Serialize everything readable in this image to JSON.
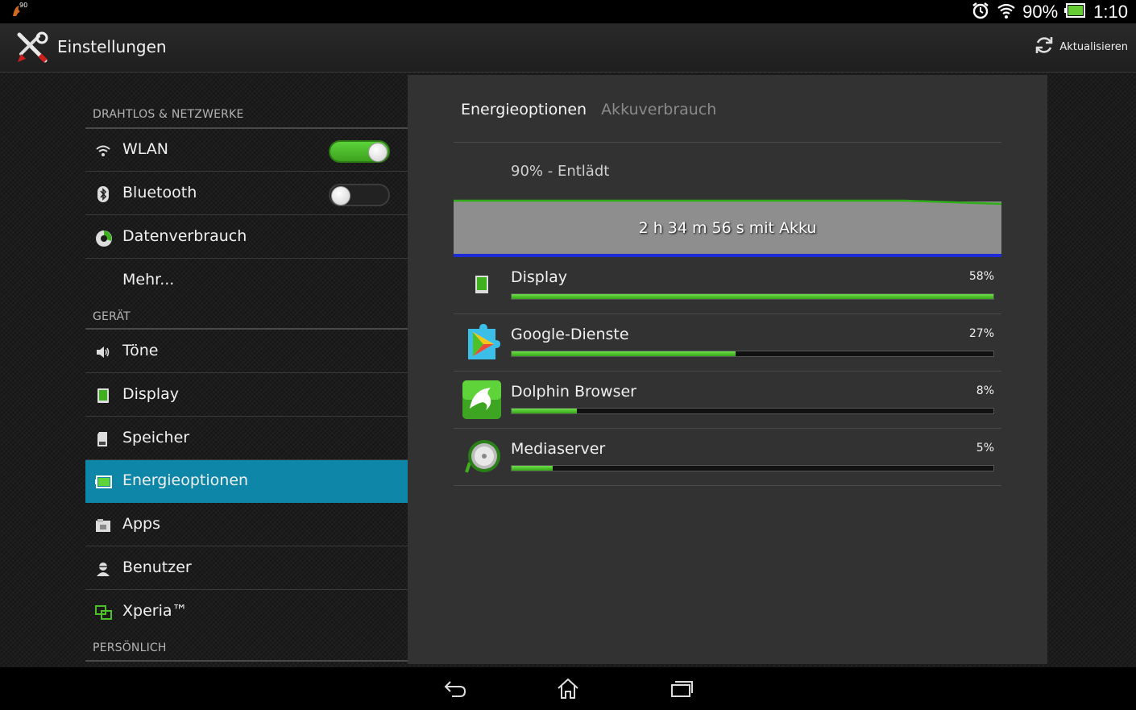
{
  "statusbar": {
    "notification_badge": "90",
    "battery_percent": "90%",
    "time": "1:10",
    "icons": [
      "alarm-icon",
      "wifi-icon",
      "battery-icon"
    ]
  },
  "actionbar": {
    "title": "Einstellungen",
    "refresh_label": "Aktualisieren"
  },
  "sidebar": {
    "sections": {
      "wireless": "DRAHTLOS & NETZWERKE",
      "device": "GERÄT",
      "personal": "PERSÖNLICH"
    },
    "items": {
      "wlan": "WLAN",
      "bluetooth": "Bluetooth",
      "data_usage": "Datenverbrauch",
      "more": "Mehr...",
      "sounds": "Töne",
      "display": "Display",
      "storage": "Speicher",
      "power": "Energieoptionen",
      "apps": "Apps",
      "users": "Benutzer",
      "xperia": "Xperia™"
    },
    "toggles": {
      "wlan": true,
      "bluetooth": false
    },
    "active_item": "power"
  },
  "panel": {
    "tabs": {
      "active": "Energieoptionen",
      "inactive": "Akkuverbrauch"
    },
    "status": "90% - Entlädt",
    "graph_label": "2 h 34 m 56 s mit Akku",
    "usage": [
      {
        "name": "Display",
        "percent_label": "58%",
        "fraction": 1.0,
        "icon": "display-icon"
      },
      {
        "name": "Google-Dienste",
        "percent_label": "27%",
        "fraction": 0.465,
        "icon": "google-services-icon"
      },
      {
        "name": "Dolphin Browser",
        "percent_label": "8%",
        "fraction": 0.135,
        "icon": "dolphin-browser-icon"
      },
      {
        "name": "Mediaserver",
        "percent_label": "5%",
        "fraction": 0.085,
        "icon": "mediaserver-icon"
      }
    ]
  },
  "colors": {
    "accent": "#0e86a8",
    "toggle_on": "#4cc12a",
    "bar_fill": "#4ccb2a",
    "graph_line": "#2fae1a",
    "graph_bottom": "#1c2bd6"
  }
}
